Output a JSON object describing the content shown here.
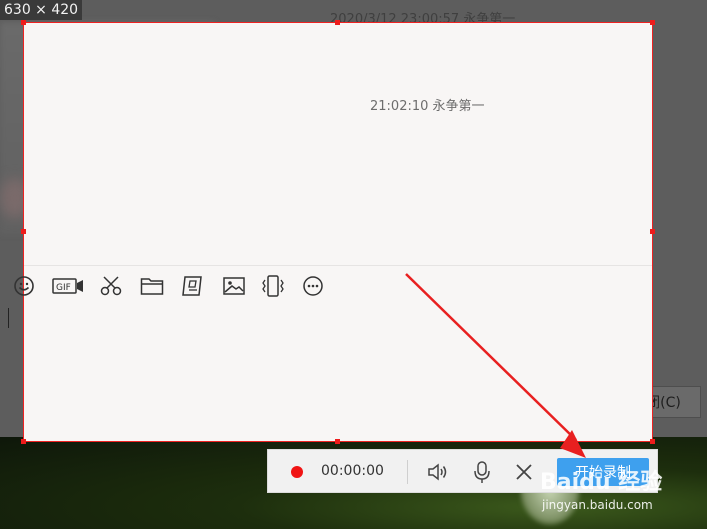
{
  "overlay": {
    "size_label": "630 × 420"
  },
  "chat": {
    "dim_timestamp": "2020/3/12 23:00:57 永争第一",
    "selected_timestamp": "21:02:10 永争第一",
    "close_button_label": "关闭(C)",
    "toolbar_icons": [
      "emoji-icon",
      "gif-icon",
      "scissors-icon",
      "folder-icon",
      "screen-record-icon",
      "image-icon",
      "vibrate-icon",
      "more-icon"
    ],
    "gif_text": "GIF"
  },
  "recorder": {
    "timer": "00:00:00",
    "start_label": "开始录制",
    "record_color": "#f01414",
    "start_color": "#3ea0ee"
  },
  "watermark": {
    "logo": "Baidu 经验",
    "url": "jingyan.baidu.com"
  },
  "colors": {
    "selection_border": "#ee2222",
    "arrow": "#e82020"
  }
}
